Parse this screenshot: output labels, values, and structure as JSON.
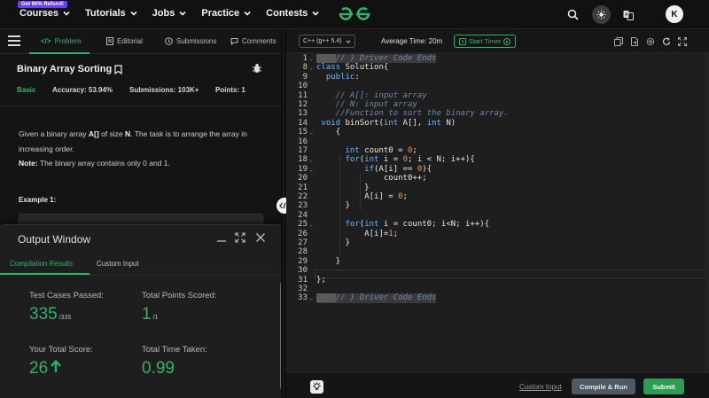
{
  "nav": {
    "promo": "Get 90% Refund!",
    "items": [
      {
        "label": "Courses"
      },
      {
        "label": "Tutorials"
      },
      {
        "label": "Jobs"
      },
      {
        "label": "Practice"
      },
      {
        "label": "Contests"
      }
    ],
    "avatar_initial": "K",
    "brand_color": "#2fb36a"
  },
  "left_tabs": [
    {
      "label": "Problem",
      "icon": "code-icon",
      "active": true
    },
    {
      "label": "Editorial",
      "icon": "document-icon"
    },
    {
      "label": "Submissions",
      "icon": "history-icon"
    },
    {
      "label": "Comments",
      "icon": "comment-icon"
    }
  ],
  "problem": {
    "title": "Binary Array Sorting",
    "difficulty": "Basic",
    "accuracy": "Accuracy: 53.94%",
    "submissions": "Submissions: 103K+",
    "points": "Points: 1",
    "desc_1a": "Given a binary array ",
    "desc_1b": "A[]",
    "desc_1c": " of size ",
    "desc_1d": "N",
    "desc_1e": ". The task is to arrange the array in increasing order.",
    "note_label": "Note:",
    "note_text": " The binary array contains only 0  and 1.",
    "example_label": "Example 1:"
  },
  "output": {
    "title": "Output Window",
    "tabs": [
      "Compilation Results",
      "Custom Input"
    ],
    "test_cases_label": "Test Cases Passed:",
    "test_cases_value": "335",
    "test_cases_total": "/335",
    "points_label": "Total Points Scored:",
    "points_value": "1",
    "points_total": "/1",
    "score_label": "Your Total Score:",
    "score_value": "26",
    "time_label": "Total Time Taken:",
    "time_value": "0.99"
  },
  "editor": {
    "language": "C++ (g++ 5.4)",
    "avg_time": "Average Time: 20m",
    "timer_label": "Start Timer",
    "custom_input": "Custom Input",
    "compile_run": "Compile & Run",
    "submit": "Submit"
  },
  "code": [
    {
      "n": "1",
      "fold": true,
      "tokens": [
        [
          "ro",
          "____"
        ],
        [
          "cm",
          "// } Driver Code Ends"
        ]
      ],
      "hl": true
    },
    {
      "n": "8",
      "fold": true,
      "tokens": [
        [
          "kw",
          "class"
        ],
        [
          "op",
          " Solution{"
        ]
      ]
    },
    {
      "n": "9",
      "tokens": [
        [
          "kw",
          "  public"
        ],
        [
          "op",
          ":"
        ]
      ]
    },
    {
      "n": "10",
      "tokens": []
    },
    {
      "n": "11",
      "tokens": [
        [
          "cm",
          "    // A[]: input array"
        ]
      ]
    },
    {
      "n": "12",
      "tokens": [
        [
          "cm",
          "    // N: input array"
        ]
      ]
    },
    {
      "n": "13",
      "tokens": [
        [
          "cm",
          "    //Function to sort the binary array."
        ]
      ]
    },
    {
      "n": "14",
      "tokens": [
        [
          "kw",
          " void"
        ],
        [
          "op",
          " binSort("
        ],
        [
          "kw",
          "int"
        ],
        [
          "op",
          " A[], "
        ],
        [
          "kw",
          "int"
        ],
        [
          "op",
          " N)"
        ]
      ]
    },
    {
      "n": "15",
      "fold": true,
      "tokens": [
        [
          "op",
          "    {"
        ]
      ]
    },
    {
      "n": "16",
      "tokens": []
    },
    {
      "n": "17",
      "tokens": [
        [
          "kw",
          "      int"
        ],
        [
          "op",
          " count0 = "
        ],
        [
          "num",
          "0"
        ],
        [
          "op",
          ";"
        ]
      ]
    },
    {
      "n": "18",
      "fold": true,
      "tokens": [
        [
          "kw",
          "      for"
        ],
        [
          "op",
          "("
        ],
        [
          "kw",
          "int"
        ],
        [
          "op",
          " i = "
        ],
        [
          "num",
          "0"
        ],
        [
          "op",
          "; i < N; i++){"
        ]
      ]
    },
    {
      "n": "19",
      "fold": true,
      "tokens": [
        [
          "kw",
          "          if"
        ],
        [
          "op",
          "(A[i] == "
        ],
        [
          "num",
          "0"
        ],
        [
          "op",
          "){"
        ]
      ]
    },
    {
      "n": "20",
      "tokens": [
        [
          "op",
          "              count0++;"
        ]
      ]
    },
    {
      "n": "21",
      "tokens": [
        [
          "op",
          "          }"
        ]
      ]
    },
    {
      "n": "22",
      "tokens": [
        [
          "op",
          "          A[i] = "
        ],
        [
          "num",
          "0"
        ],
        [
          "op",
          ";"
        ]
      ]
    },
    {
      "n": "23",
      "tokens": [
        [
          "op",
          "      }"
        ]
      ]
    },
    {
      "n": "24",
      "tokens": []
    },
    {
      "n": "25",
      "fold": true,
      "tokens": [
        [
          "kw",
          "      for"
        ],
        [
          "op",
          "("
        ],
        [
          "kw",
          "int"
        ],
        [
          "op",
          " i = count0; i<N; i++){"
        ]
      ]
    },
    {
      "n": "26",
      "tokens": [
        [
          "op",
          "          A[i]="
        ],
        [
          "num",
          "1"
        ],
        [
          "op",
          ";"
        ]
      ]
    },
    {
      "n": "27",
      "tokens": [
        [
          "op",
          "      }"
        ]
      ]
    },
    {
      "n": "28",
      "tokens": []
    },
    {
      "n": "29",
      "tokens": [
        [
          "op",
          "    }"
        ]
      ]
    },
    {
      "n": "30",
      "tokens": []
    },
    {
      "n": "31",
      "tokens": [
        [
          "op",
          "};"
        ]
      ]
    },
    {
      "n": "32",
      "tokens": []
    },
    {
      "n": "33",
      "fold": true,
      "tokens": [
        [
          "ro",
          "____"
        ],
        [
          "cm",
          "// } Driver Code Ends"
        ]
      ],
      "hl": true
    }
  ]
}
